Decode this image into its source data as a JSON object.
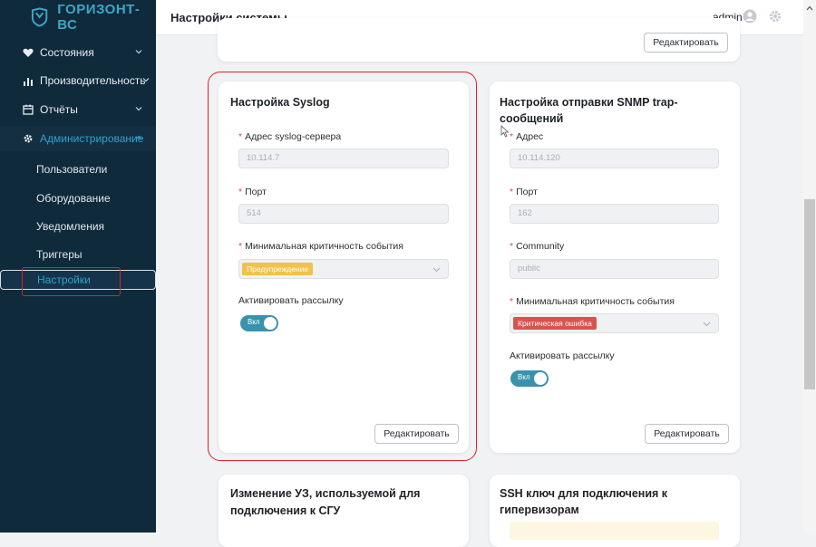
{
  "app": {
    "brand": "ГОРИЗОНТ-ВС"
  },
  "sidebar": {
    "items": [
      {
        "label": "Состояния"
      },
      {
        "label": "Производительность"
      },
      {
        "label": "Отчёты"
      },
      {
        "label": "Администрирование"
      }
    ],
    "subitems": [
      {
        "label": "Пользователи"
      },
      {
        "label": "Оборудование"
      },
      {
        "label": "Уведомления"
      },
      {
        "label": "Триггеры"
      },
      {
        "label": "Настройки"
      }
    ]
  },
  "header": {
    "title": "Настройки системы",
    "user": "admin"
  },
  "top_card": {
    "edit_label": "Редактировать"
  },
  "syslog": {
    "title": "Настройка Syslog",
    "server_label": "Адрес syslog-сервера",
    "server_value": "10.114.7",
    "port_label": "Порт",
    "port_value": "514",
    "severity_label": "Минимальная критичность события",
    "severity_value": "Предупреждение",
    "enable_label": "Активировать рассылку",
    "toggle_label": "Вкл",
    "edit_label": "Редактировать"
  },
  "snmp": {
    "title": "Настройка отправки SNMP trap-сообщений",
    "address_label": "Адрес",
    "address_value": "10.114.120",
    "port_label": "Порт",
    "port_value": "162",
    "community_label": "Community",
    "community_value": "public",
    "severity_label": "Минимальная критичность события",
    "severity_value": "Критическая ошибка",
    "enable_label": "Активировать рассылку",
    "toggle_label": "Вкл",
    "edit_label": "Редактировать"
  },
  "bottom_cards": {
    "left_title_line1": "Изменение УЗ, используемой для",
    "left_title_line2": "подключения к СГУ",
    "right_title": "SSH ключ для подключения к гипервизорам"
  },
  "colors": {
    "sidebar_bg": "#0f2a3b",
    "accent": "#2ba4cf",
    "warning_tag": "#f2c14a",
    "critical_tag": "#d9534f",
    "toggle_on": "#3a93ad",
    "highlight": "#e0202a"
  }
}
